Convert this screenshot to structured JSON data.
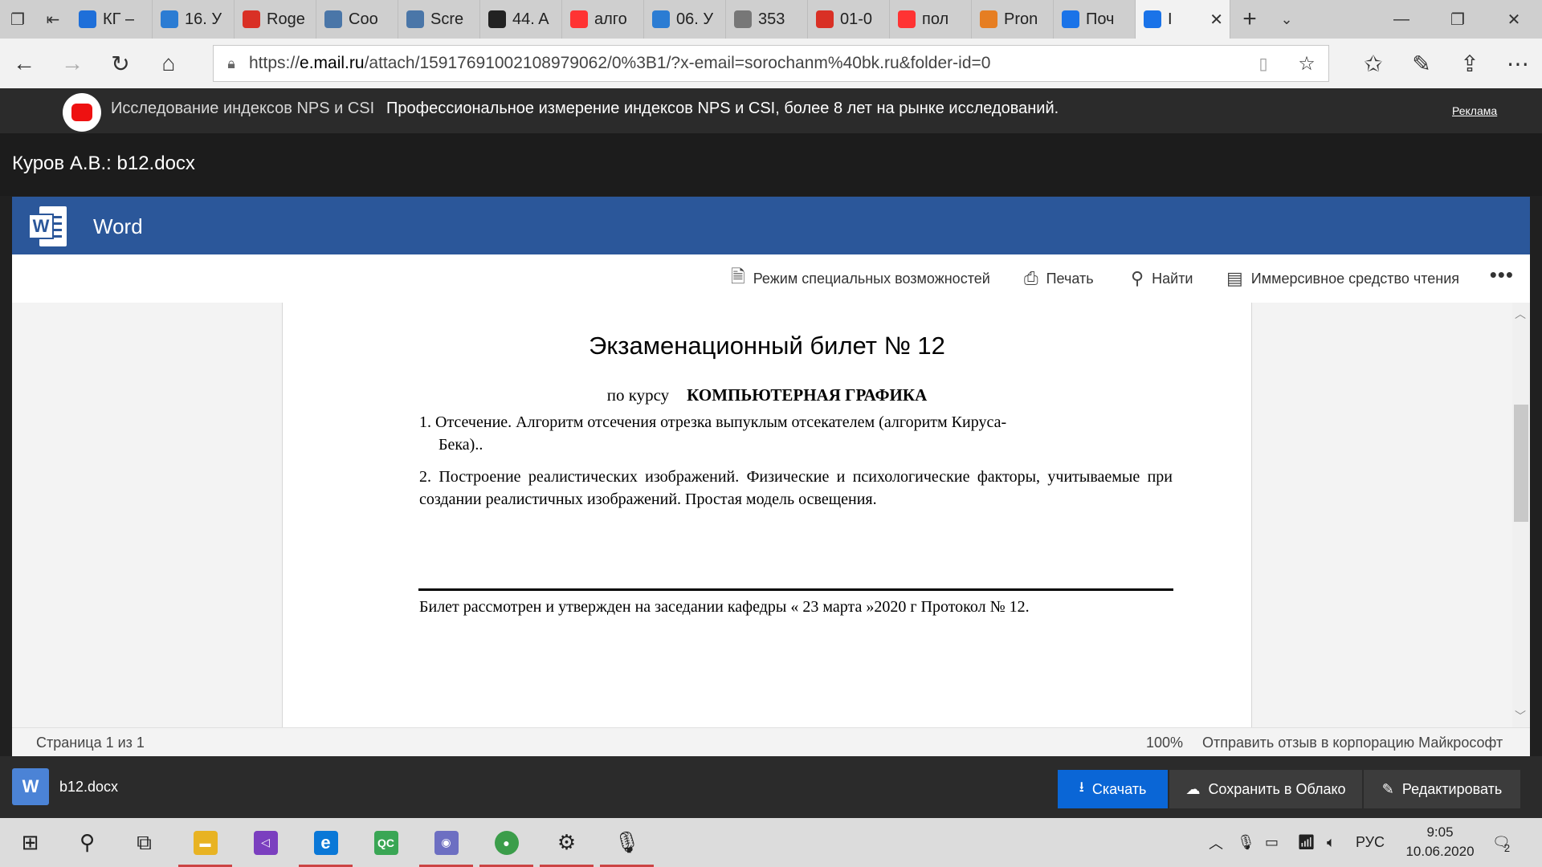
{
  "browser": {
    "tabs": [
      {
        "label": "КГ –",
        "icon": "onedrive-icon",
        "color": "#1e6fd9"
      },
      {
        "label": "16. У",
        "icon": "document-icon",
        "color": "#2b7cd3"
      },
      {
        "label": "Roge",
        "icon": "pdf-icon",
        "color": "#d93025"
      },
      {
        "label": "Coo",
        "icon": "vk-icon",
        "color": "#4a76a8"
      },
      {
        "label": "Scre",
        "icon": "vk-icon",
        "color": "#4a76a8"
      },
      {
        "label": "44. A",
        "icon": "github-icon",
        "color": "#222222"
      },
      {
        "label": "алго",
        "icon": "yandex-icon",
        "color": "#ff3333"
      },
      {
        "label": "06. У",
        "icon": "table-icon",
        "color": "#2b7cd3"
      },
      {
        "label": "353",
        "icon": "web-icon",
        "color": "#777777"
      },
      {
        "label": "01-0",
        "icon": "pdf-icon",
        "color": "#d93025"
      },
      {
        "label": "пол",
        "icon": "yandex-icon",
        "color": "#ff3333"
      },
      {
        "label": "Pron",
        "icon": "cg-icon",
        "color": "#e67e22"
      },
      {
        "label": "Поч",
        "icon": "mail-icon",
        "color": "#1a73e8"
      },
      {
        "label": "I",
        "icon": "mail-icon",
        "color": "#1a73e8",
        "active": true
      }
    ],
    "url_prefix": "https://",
    "url_domain": "e.mail.ru",
    "url_rest": "/attach/15917691002108979062/0%3B1/?x-email=sorochanm%40bk.ru&folder-id=0"
  },
  "ad": {
    "title": "Исследование индексов NPS и CSI",
    "text": "Профессиональное измерение индексов NPS и CSI, более 8 лет на рынке исследований.",
    "label": "Реклама"
  },
  "viewer": {
    "file_title": "Куров А.В.: b12.docx",
    "app_name": "Word",
    "toolbar": {
      "accessibility": "Режим специальных возможностей",
      "print": "Печать",
      "find": "Найти",
      "immersive": "Иммерсивное средство чтения",
      "more": "•••"
    },
    "document": {
      "heading": "Экзаменационный билет № 12",
      "sub_prefix": "по курсу",
      "course": "КОМПЬЮТЕРНАЯ ГРАФИКА",
      "q1_num": "1.",
      "q1_line1": "Отсечение.  Алгоритм отсечения отрезка выпуклым отсекателем (алгоритм Кируса-",
      "q1_line2": "Бека)..",
      "q2": "2. Построение реалистических изображений. Физические и  психологические  факторы, учитываемые  при  создании реалистичных изображений. Простая модель освещения.",
      "footer": "Билет рассмотрен и утвержден на заседании кафедры  « 23 марта »2020  г Протокол № 12."
    },
    "status": {
      "page": "Страница 1 из 1",
      "zoom": "100%",
      "feedback": "Отправить отзыв в корпорацию Майкрософт"
    }
  },
  "attachment": {
    "file_name": "b12.docx",
    "download": "Скачать",
    "save_cloud": "Сохранить в Облако",
    "edit": "Редактировать"
  },
  "taskbar": {
    "language": "РУС",
    "time": "9:05",
    "date": "10.06.2020",
    "notifications": "2"
  }
}
